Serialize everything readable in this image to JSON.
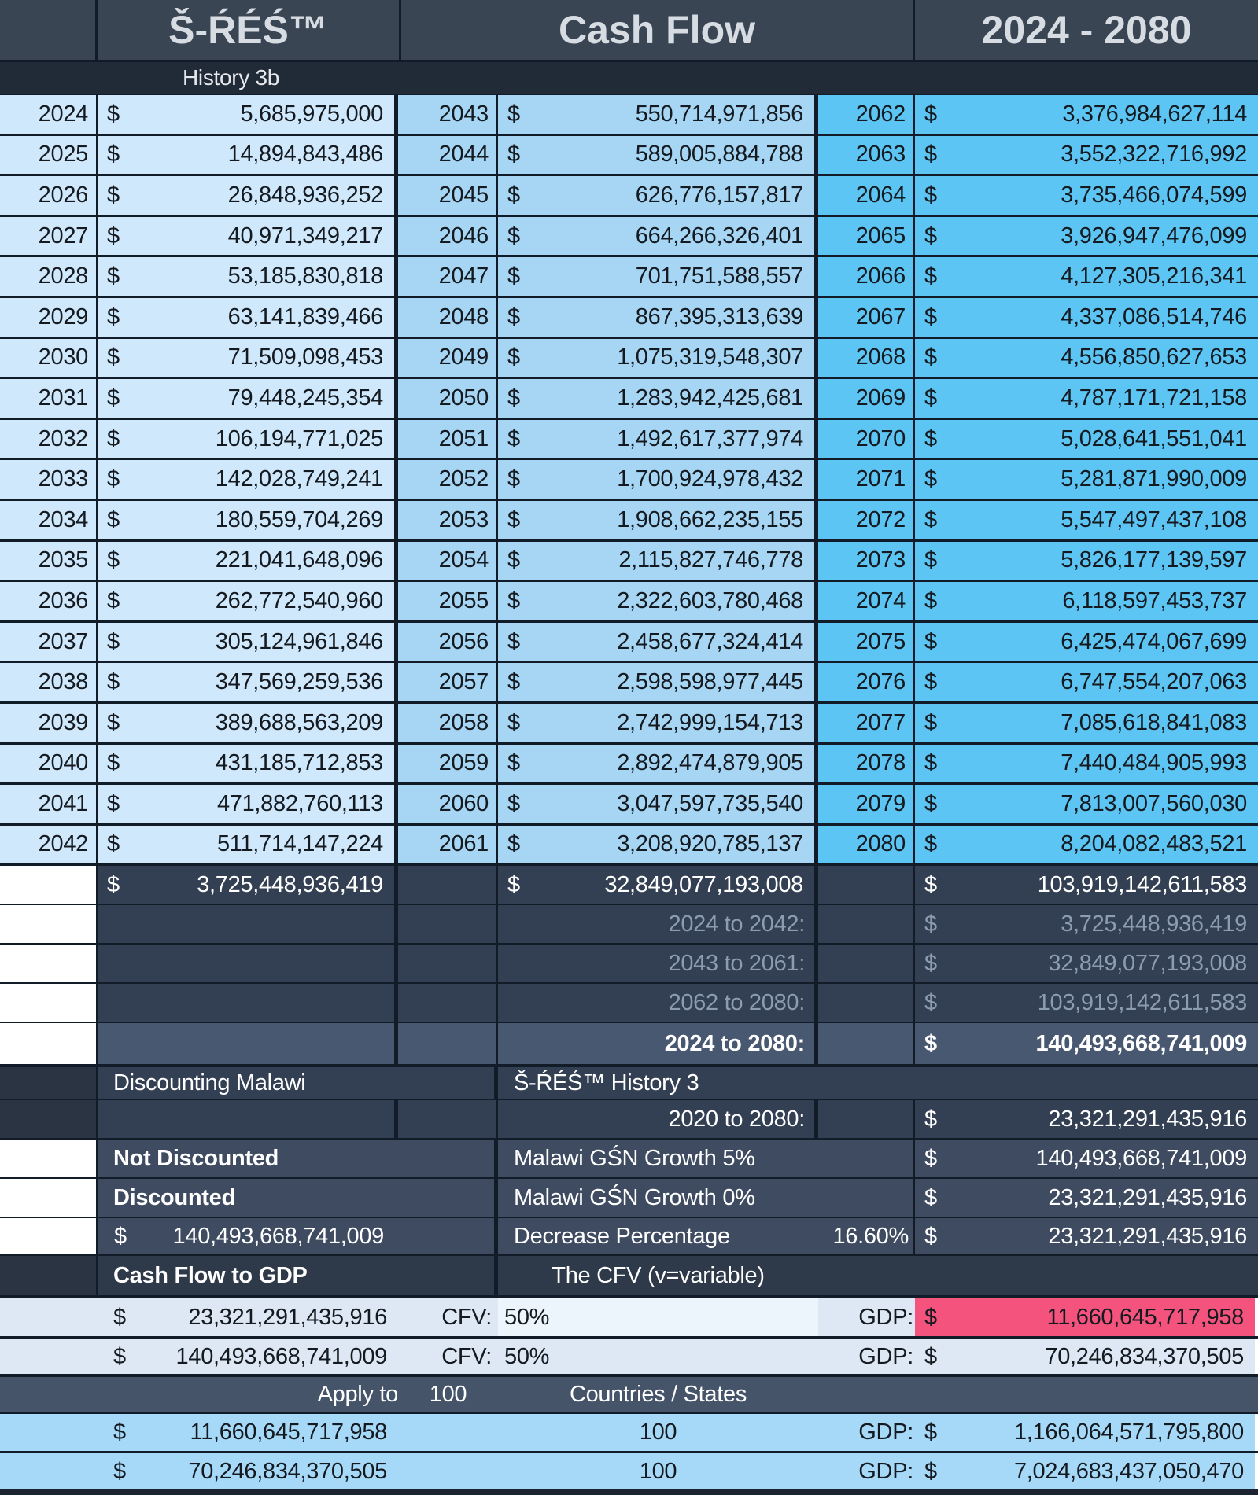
{
  "header": {
    "left_title": "Š-ŔÉŚ™",
    "center_title": "Cash Flow",
    "right_title": "2024 - 2080",
    "subtitle": "History 3b"
  },
  "table": {
    "currency_symbol": "$",
    "groups": [
      {
        "years": [
          2024,
          2025,
          2026,
          2027,
          2028,
          2029,
          2030,
          2031,
          2032,
          2033,
          2034,
          2035,
          2036,
          2037,
          2038,
          2039,
          2040,
          2041,
          2042
        ],
        "values": [
          "5,685,975,000",
          "14,894,843,486",
          "26,848,936,252",
          "40,971,349,217",
          "53,185,830,818",
          "63,141,839,466",
          "71,509,098,453",
          "79,448,245,354",
          "106,194,771,025",
          "142,028,749,241",
          "180,559,704,269",
          "221,041,648,096",
          "262,772,540,960",
          "305,124,961,846",
          "347,569,259,536",
          "389,688,563,209",
          "431,185,712,853",
          "471,882,760,113",
          "511,714,147,224"
        ],
        "total": "3,725,448,936,419"
      },
      {
        "years": [
          2043,
          2044,
          2045,
          2046,
          2047,
          2048,
          2049,
          2050,
          2051,
          2052,
          2053,
          2054,
          2055,
          2056,
          2057,
          2058,
          2059,
          2060,
          2061
        ],
        "values": [
          "550,714,971,856",
          "589,005,884,788",
          "626,776,157,817",
          "664,266,326,401",
          "701,751,588,557",
          "867,395,313,639",
          "1,075,319,548,307",
          "1,283,942,425,681",
          "1,492,617,377,974",
          "1,700,924,978,432",
          "1,908,662,235,155",
          "2,115,827,746,778",
          "2,322,603,780,468",
          "2,458,677,324,414",
          "2,598,598,977,445",
          "2,742,999,154,713",
          "2,892,474,879,905",
          "3,047,597,735,540",
          "3,208,920,785,137"
        ],
        "total": "32,849,077,193,008"
      },
      {
        "years": [
          2062,
          2063,
          2064,
          2065,
          2066,
          2067,
          2068,
          2069,
          2070,
          2071,
          2072,
          2073,
          2074,
          2075,
          2076,
          2077,
          2078,
          2079,
          2080
        ],
        "values": [
          "3,376,984,627,114",
          "3,552,322,716,992",
          "3,735,466,074,599",
          "3,926,947,476,099",
          "4,127,305,216,341",
          "4,337,086,514,746",
          "4,556,850,627,653",
          "4,787,171,721,158",
          "5,028,641,551,041",
          "5,281,871,990,009",
          "5,547,497,437,108",
          "5,826,177,139,597",
          "6,118,597,453,737",
          "6,425,474,067,699",
          "6,747,554,207,063",
          "7,085,618,841,083",
          "7,440,484,905,993",
          "7,813,007,560,030",
          "8,204,082,483,521"
        ],
        "total": "103,919,142,611,583"
      }
    ]
  },
  "range_summary": [
    {
      "label": "2024 to 2042:",
      "value": "3,725,448,936,419"
    },
    {
      "label": "2043 to 2061:",
      "value": "32,849,077,193,008"
    },
    {
      "label": "2062 to 2080:",
      "value": "103,919,142,611,583"
    },
    {
      "label": "2024 to 2080:",
      "value": "140,493,668,741,009"
    }
  ],
  "discounting": {
    "left_header": "Discounting Malawi",
    "right_header": "Š-ŔÉŚ™ History 3",
    "range_row": {
      "label": "2020 to 2080:",
      "value": "23,321,291,435,916"
    },
    "rows": [
      {
        "left": "Not Discounted",
        "mid": "Malawi GŚN Growth 5%",
        "value": "140,493,668,741,009"
      },
      {
        "left": "Discounted",
        "mid": "Malawi GŚN Growth 0%",
        "value": "23,321,291,435,916"
      },
      {
        "left_amount": "140,493,668,741,009",
        "mid": "Decrease Percentage",
        "pct": "16.60%",
        "value": "23,321,291,435,916"
      }
    ]
  },
  "cashflow_gdp": {
    "left_header": "Cash Flow to GDP",
    "mid_header": "The CFV (v=variable)",
    "rows": [
      {
        "amount": "23,321,291,435,916",
        "cfv_label": "CFV:",
        "cfv_value": "50%",
        "gdp_label": "GDP:",
        "gdp_value": "11,660,645,717,958"
      },
      {
        "amount": "140,493,668,741,009",
        "cfv_label": "CFV:",
        "cfv_value": "50%",
        "gdp_label": "GDP:",
        "gdp_value": "70,246,834,370,505"
      }
    ]
  },
  "apply": {
    "label": "Apply to",
    "count": "100",
    "suffix": "Countries / States",
    "rows": [
      {
        "amount": "11,660,645,717,958",
        "count": "100",
        "gdp_label": "GDP:",
        "gdp_value": "1,166,064,571,795,800"
      },
      {
        "amount": "70,246,834,370,505",
        "count": "100",
        "gdp_label": "GDP:",
        "gdp_value": "7,024,683,437,050,470"
      }
    ]
  },
  "colors": {
    "accent_pink": "#f4537d",
    "group1_blue": "#cfe8fb",
    "group2_blue": "#a6d6f4",
    "group3_blue": "#5cc5f3"
  }
}
